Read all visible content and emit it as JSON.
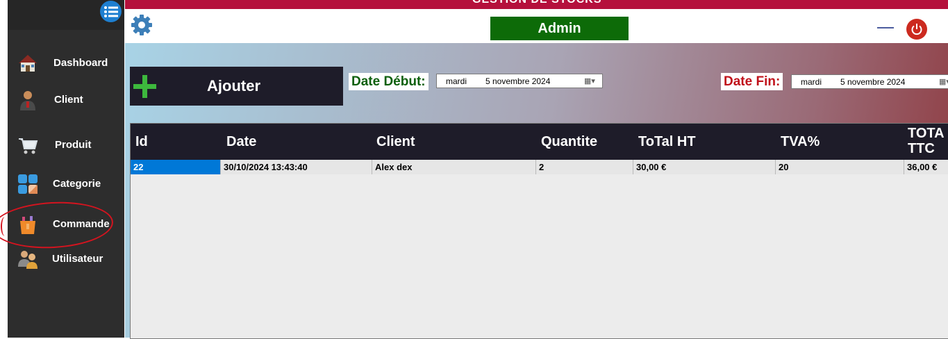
{
  "app": {
    "title": "GESTION DE STOCKS"
  },
  "header": {
    "user_label": "Admin"
  },
  "sidebar": {
    "items": [
      {
        "label": "Dashboard",
        "icon": "house-icon"
      },
      {
        "label": "Client",
        "icon": "person-icon"
      },
      {
        "label": "Produit",
        "icon": "cart-icon"
      },
      {
        "label": "Categorie",
        "icon": "tiles-icon"
      },
      {
        "label": "Commande",
        "icon": "bag-icon"
      },
      {
        "label": "Utilisateur",
        "icon": "users-icon"
      }
    ]
  },
  "toolbar": {
    "add_label": "Ajouter",
    "start_label": "Date Début:",
    "start_day": "mardi",
    "start_date": "5 novembre 2024",
    "end_label": "Date Fin:",
    "end_day": "mardi",
    "end_date": "5 novembre 2024"
  },
  "table": {
    "columns": [
      "Id",
      "Date",
      "Client",
      "Quantite",
      "ToTal HT",
      "TVA%",
      "TOTA TTC"
    ],
    "rows": [
      [
        "22",
        "30/10/2024 13:43:40",
        "Alex dex",
        "2",
        "30,00 €",
        "20",
        "36,00 €"
      ]
    ]
  },
  "colors": {
    "title_bar": "#b5103c",
    "sidebar": "#2d2d2d",
    "admin_badge": "#0d6b08",
    "table_header": "#1e1c29",
    "selection": "#0078d7",
    "start_label_text": "#0b5f0b",
    "end_label_text": "#c0101a"
  }
}
